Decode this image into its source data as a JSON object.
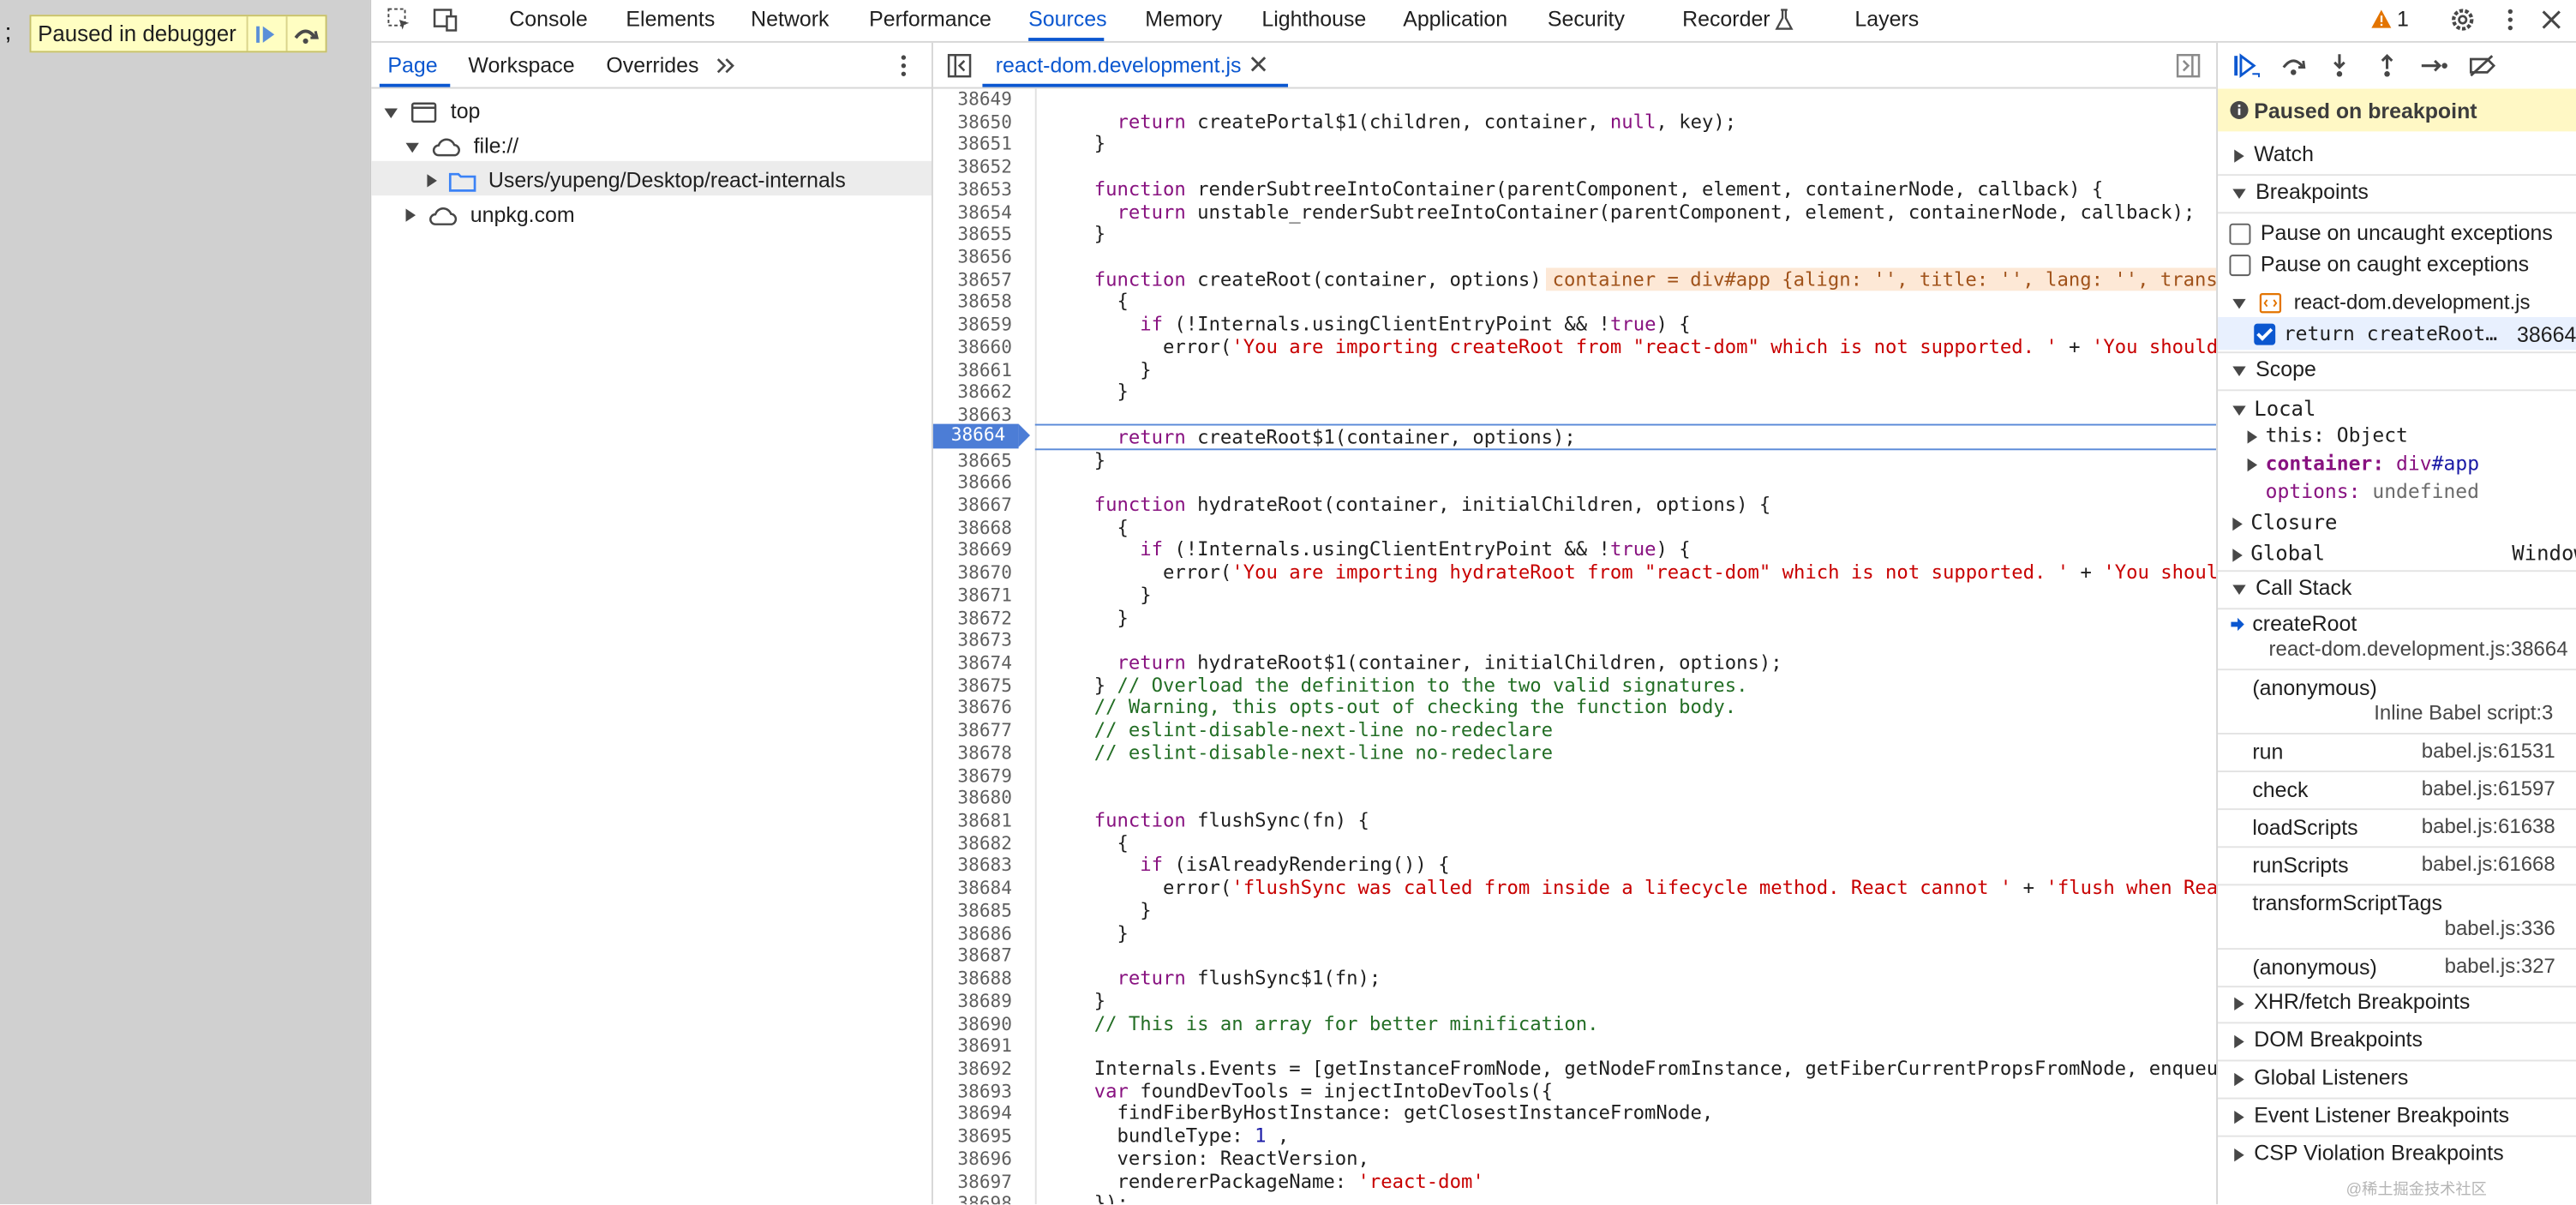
{
  "page": {
    "semicolon": ";",
    "paused_label": "Paused in debugger"
  },
  "devtools": {
    "main_tabs": [
      "Console",
      "Elements",
      "Network",
      "Performance",
      "Sources",
      "Memory",
      "Lighthouse",
      "Application",
      "Security",
      "Recorder",
      "Layers"
    ],
    "active_tab": "Sources",
    "issues_count": "1",
    "navigator": {
      "tabs": [
        "Page",
        "Workspace",
        "Overrides"
      ],
      "active_tab": "Page",
      "tree": [
        "top",
        "file://",
        "Users/yupeng/Desktop/react-internals",
        "unpkg.com"
      ]
    },
    "editor": {
      "file_tab": "react-dom.development.js",
      "first_line": 38649,
      "current_line": "38664",
      "inline_value": "container = div#app {align: '', title: '', lang: '', trans",
      "lines": [
        "",
        "    return createPortal$1(children, container, null, key);",
        "  }",
        "",
        "  function renderSubtreeIntoContainer(parentComponent, element, containerNode, callback) {",
        "    return unstable_renderSubtreeIntoContainer(parentComponent, element, containerNode, callback);",
        "  }",
        "",
        "  function createRoot(container, options) {",
        "    {",
        "      if (!Internals.usingClientEntryPoint && !true) {",
        "        error('You are importing createRoot from \"react-dom\" which is not supported. ' + 'You should in",
        "      }",
        "    }",
        "",
        "    return createRoot$1(container, options);",
        "  }",
        "",
        "  function hydrateRoot(container, initialChildren, options) {",
        "    {",
        "      if (!Internals.usingClientEntryPoint && !true) {",
        "        error('You are importing hydrateRoot from \"react-dom\" which is not supported. ' + 'You should i",
        "      }",
        "    }",
        "",
        "    return hydrateRoot$1(container, initialChildren, options);",
        "  } // Overload the definition to the two valid signatures.",
        "  // Warning, this opts-out of checking the function body.",
        "  // eslint-disable-next-line no-redeclare",
        "  // eslint-disable-next-line no-redeclare",
        "",
        "",
        "  function flushSync(fn) {",
        "    {",
        "      if (isAlreadyRendering()) {",
        "        error('flushSync was called from inside a lifecycle method. React cannot ' + 'flush when React",
        "      }",
        "    }",
        "",
        "    return flushSync$1(fn);",
        "  }",
        "  // This is an array for better minification.",
        "",
        "  Internals.Events = [getInstanceFromNode, getNodeFromInstance, getFiberCurrentPropsFromNode, enqueueSt",
        "  var foundDevTools = injectIntoDevTools({",
        "    findFiberByHostInstance: getClosestInstanceFromNode,",
        "    bundleType: 1 ,",
        "    version: ReactVersion,",
        "    rendererPackageName: 'react-dom'",
        "  });"
      ]
    },
    "sidebar": {
      "paused_banner": "Paused on breakpoint",
      "watch": "Watch",
      "breakpoints": "Breakpoints",
      "pause_uncaught": "Pause on uncaught exceptions",
      "pause_caught": "Pause on caught exceptions",
      "bp_file": "react-dom.development.js",
      "bp_code": "return createRoot…",
      "bp_line": "38664",
      "scope": "Scope",
      "local": "Local",
      "scope_this_key": "this:",
      "scope_this_val": "Object",
      "scope_container_key": "container:",
      "scope_container_val1": "div",
      "scope_container_val2": "#app",
      "scope_options_key": "options:",
      "scope_options_val": "undefined",
      "closure": "Closure",
      "global": "Global",
      "global_val": "Window",
      "call_stack": "Call Stack",
      "frames": [
        {
          "name": "createRoot",
          "loc": "react-dom.development.js:38664"
        },
        {
          "name": "(anonymous)",
          "loc": "Inline Babel script:3"
        },
        {
          "name": "run",
          "loc": "babel.js:61531"
        },
        {
          "name": "check",
          "loc": "babel.js:61597"
        },
        {
          "name": "loadScripts",
          "loc": "babel.js:61638"
        },
        {
          "name": "runScripts",
          "loc": "babel.js:61668"
        },
        {
          "name": "transformScriptTags",
          "loc": "babel.js:336"
        },
        {
          "name": "(anonymous)",
          "loc": "babel.js:327"
        }
      ],
      "xhr": "XHR/fetch Breakpoints",
      "dom": "DOM Breakpoints",
      "global_listeners": "Global Listeners",
      "event_listener": "Event Listener Breakpoints",
      "csp": "CSP Violation Breakpoints"
    }
  },
  "watermark": "@稀土掘金技术社区",
  "colors": {
    "accent": "#0b57d0",
    "paused_bg": "#fffec2",
    "breakpoint": "#4c7dd6"
  }
}
